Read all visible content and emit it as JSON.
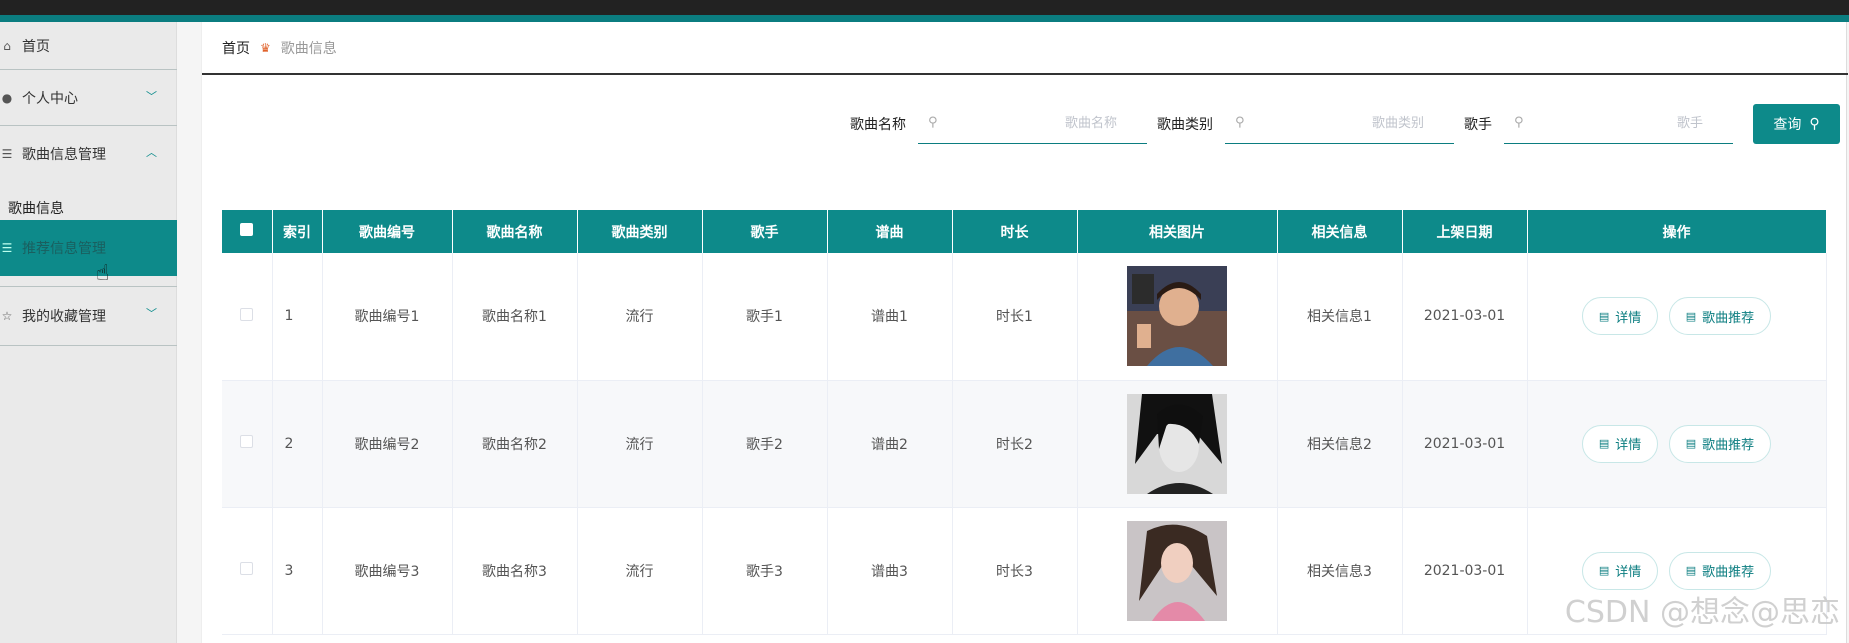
{
  "sidebar": {
    "items": [
      {
        "label": "首页",
        "icon": "home-icon"
      },
      {
        "label": "个人中心",
        "icon": "user-icon"
      },
      {
        "label": "歌曲信息管理",
        "icon": "list-icon"
      },
      {
        "label": "我的收藏管理",
        "icon": "star-icon"
      }
    ],
    "submenu_title": "歌曲信息",
    "active_item": {
      "label": "推荐信息管理",
      "icon": "list-icon"
    }
  },
  "breadcrumb": {
    "home": "首页",
    "current": "歌曲信息"
  },
  "search": {
    "fields": [
      {
        "label": "歌曲名称",
        "placeholder": "歌曲名称"
      },
      {
        "label": "歌曲类别",
        "placeholder": "歌曲类别"
      },
      {
        "label": "歌手",
        "placeholder": "歌手"
      }
    ],
    "button_label": "查询"
  },
  "table": {
    "headers": [
      "索引",
      "歌曲编号",
      "歌曲名称",
      "歌曲类别",
      "歌手",
      "谱曲",
      "时长",
      "相关图片",
      "相关信息",
      "上架日期",
      "操作"
    ],
    "rows": [
      {
        "index": "1",
        "code": "歌曲编号1",
        "name": "歌曲名称1",
        "category": "流行",
        "singer": "歌手1",
        "composer": "谱曲1",
        "duration": "时长1",
        "info": "相关信息1",
        "date": "2021-03-01"
      },
      {
        "index": "2",
        "code": "歌曲编号2",
        "name": "歌曲名称2",
        "category": "流行",
        "singer": "歌手2",
        "composer": "谱曲2",
        "duration": "时长2",
        "info": "相关信息2",
        "date": "2021-03-01"
      },
      {
        "index": "3",
        "code": "歌曲编号3",
        "name": "歌曲名称3",
        "category": "流行",
        "singer": "歌手3",
        "composer": "谱曲3",
        "duration": "时长3",
        "info": "相关信息3",
        "date": "2021-03-01"
      }
    ],
    "actions": {
      "detail": "详情",
      "recommend": "歌曲推荐"
    }
  },
  "watermark": "CSDN @想念@思恋",
  "colors": {
    "primary": "#0d8a8a",
    "accent_dark": "#0b7d80",
    "topbar": "#222222"
  }
}
